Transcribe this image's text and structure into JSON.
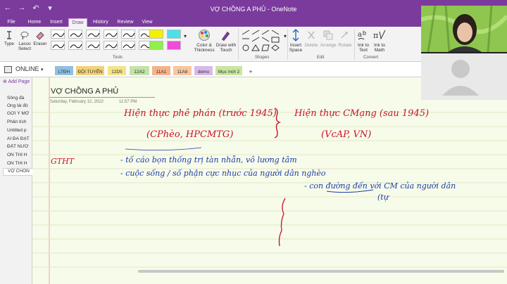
{
  "window": {
    "title": "VỢ CHỒNG A PHỦ - OneNote"
  },
  "quick_access": {
    "back": "←",
    "forward": "→",
    "undo": "↶",
    "more": "▾"
  },
  "ribbon_tabs": [
    "File",
    "Home",
    "Insert",
    "Draw",
    "History",
    "Review",
    "View"
  ],
  "active_tab": "Draw",
  "ribbon": {
    "type_label": "Type",
    "lasso_label": "Lasso Select",
    "eraser_label": "Eraser",
    "tools_group": "Tools",
    "color_label": "Color & Thickness",
    "draw_touch_label": "Draw with Touch",
    "shapes_group": "Shapes",
    "insert_space_label": "Insert Space",
    "delete_label": "Delete",
    "arrange_label": "Arrange",
    "rotate_label": "Rotate",
    "edit_group": "Edit",
    "ink_text_label": "Ink to Text",
    "ink_math_label": "Ink to Math",
    "convert_group": "Convert"
  },
  "notebook": {
    "name": "ONLINE"
  },
  "sections": [
    {
      "label": "LTĐH",
      "color": "#8fc0e0"
    },
    {
      "label": "ĐỘI TUYỂN",
      "color": "#f3d27a"
    },
    {
      "label": "12D5",
      "color": "#f4e48a"
    },
    {
      "label": "12A2",
      "color": "#c3e3a6"
    },
    {
      "label": "11A1",
      "color": "#f6b28a"
    },
    {
      "label": "11A8",
      "color": "#f7c6a0"
    },
    {
      "label": "demo",
      "color": "#d7b9ea"
    },
    {
      "label": "Mục mới 2",
      "color": "#c8e6a0"
    },
    {
      "label": "+",
      "color": "#ffffff"
    }
  ],
  "pages": {
    "add_label": "Add Page",
    "items": [
      "Sông đà",
      "Ông lái đò",
      "GỢI Ý MỞ",
      "Phân tích",
      "Untitled p",
      "AI ĐÃ ĐẶT",
      "ĐẤT NƯỚ",
      "ÔN THI H",
      "ÔN THI H",
      "VỢ CHỒN"
    ]
  },
  "page": {
    "title": "VỢ CHỒNG A PHỦ",
    "date": "Saturday, February 12, 2022",
    "time": "11:57 PM"
  },
  "ink": {
    "left_heading": "Hiện thực phê phán (trước 1945)",
    "left_sub": "(CPhèo, HPCMTG)",
    "right_heading": "Hiện thực CMạng (sau 1945)",
    "right_sub": "(VcAP, VN)",
    "side_label": "GTHT",
    "line1": "- tố cáo bọn thống trị tàn nhẫn, vô lương tâm",
    "line2": "- cuộc sống / số phận cực nhục của người dân nghèo",
    "line3": "- con đường đến với CM của người dân",
    "line4": "(tự"
  },
  "colors": {
    "onenote_purple": "#7a3b9c",
    "ink_red": "#c9122a",
    "ink_blue": "#1b3ca8",
    "page_bg": "#f7fbe9"
  }
}
